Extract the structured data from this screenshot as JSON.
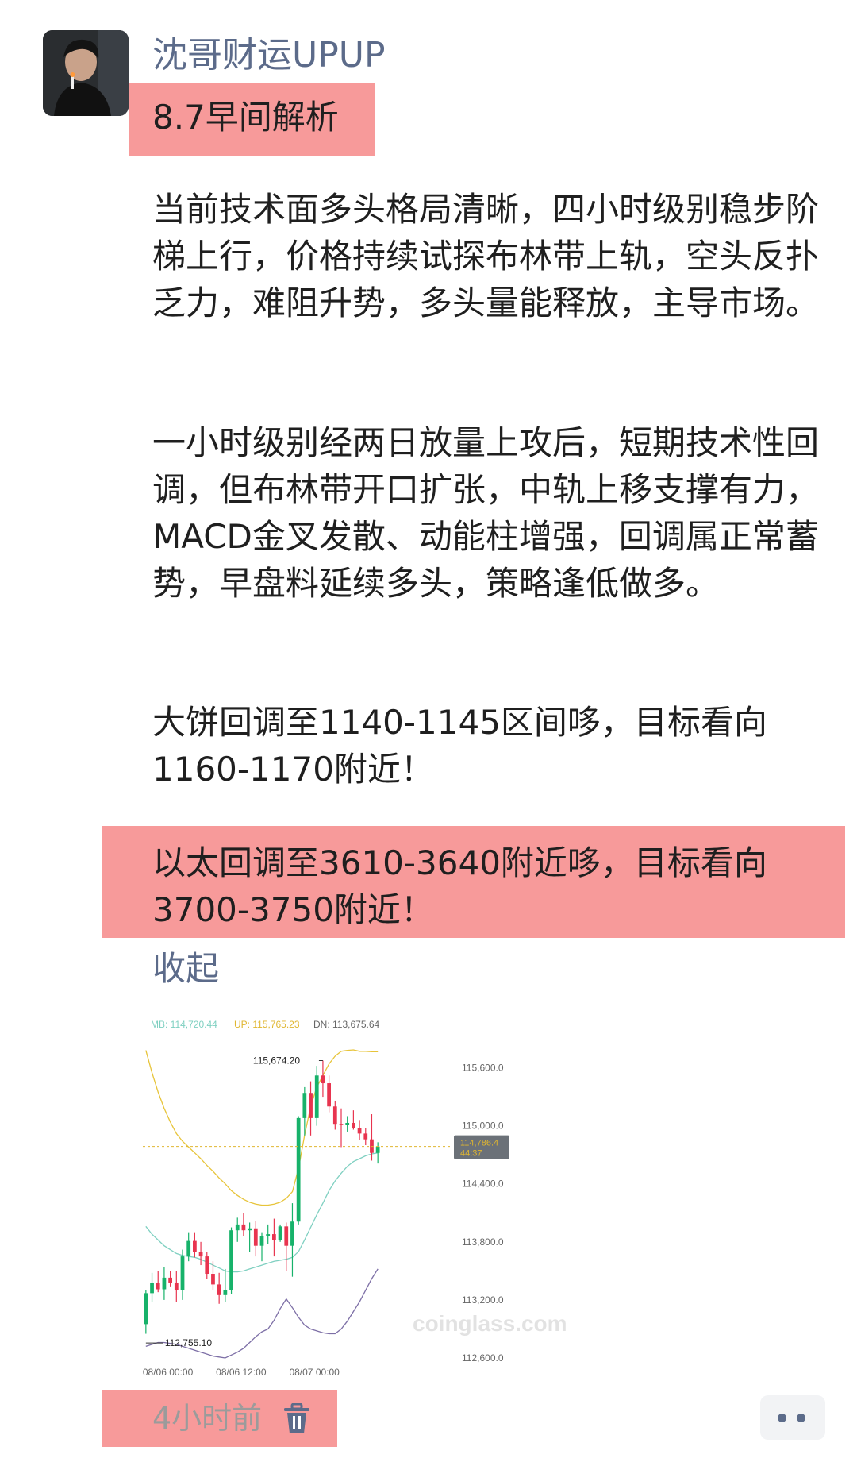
{
  "post": {
    "author": "沈哥财运UPUP",
    "title": "8.7早间解析",
    "paragraphs": [
      "当前技术面多头格局清晰，四小时级别稳步阶梯上行，价格持续试探布林带上轨，空头反扑乏力，难阻升势，多头量能释放，主导市场。",
      "一小时级别经两日放量上攻后，短期技术性回调，但布林带开口扩张，中轨上移支撑有力，MACD金叉发散、动能柱增强，回调属正常蓄势，早盘料延续多头，策略逢低做多。",
      "大饼回调至1140-1145区间哆，目标看向1160-1170附近！",
      "以太回调至3610-3640附近哆，目标看向3700-3750附近！"
    ],
    "collapse_label": "收起",
    "time_label": "4小时前"
  },
  "icons": {
    "avatar": "avatar-photo",
    "delete": "trash-icon",
    "more": "more-dots-icon"
  },
  "colors": {
    "highlight": "#f79a9a",
    "link": "#5c6b8a",
    "candle_up": "#17b26a",
    "candle_down": "#e8344f",
    "boll_up": "#e7c43a",
    "boll_mid": "#7fd0c1",
    "boll_dn": "#7d6fa6"
  },
  "chart_data": {
    "type": "candlestick",
    "legend": {
      "mb": "MB: 114,720.44",
      "up": "UP: 115,765.23",
      "dn": "DN: 113,675.64"
    },
    "x_ticks": [
      "08/06 00:00",
      "08/06 12:00",
      "08/07 00:00"
    ],
    "y_ticks": [
      "115,600.0",
      "115,000.0",
      "114,400.0",
      "113,800.0",
      "113,200.0",
      "112,600.0"
    ],
    "ylim": [
      112600,
      115900
    ],
    "high_label": "115,674.20",
    "low_label": "112,755.10",
    "high_value": 115674.2,
    "low_value": 112755.1,
    "price_tag": {
      "price": "114,786.4",
      "countdown": "44:37",
      "value": 114786.4
    },
    "watermark": "coinglass.com",
    "candles": [
      {
        "o": 112950,
        "h": 113300,
        "l": 112850,
        "c": 113270
      },
      {
        "o": 113270,
        "h": 113480,
        "l": 113180,
        "c": 113380
      },
      {
        "o": 113380,
        "h": 113500,
        "l": 113280,
        "c": 113310
      },
      {
        "o": 113310,
        "h": 113540,
        "l": 113200,
        "c": 113430
      },
      {
        "o": 113430,
        "h": 113500,
        "l": 113340,
        "c": 113380
      },
      {
        "o": 113380,
        "h": 113500,
        "l": 113180,
        "c": 113300
      },
      {
        "o": 113300,
        "h": 113720,
        "l": 113200,
        "c": 113650
      },
      {
        "o": 113650,
        "h": 113900,
        "l": 113600,
        "c": 113810
      },
      {
        "o": 113810,
        "h": 113900,
        "l": 113640,
        "c": 113700
      },
      {
        "o": 113700,
        "h": 113800,
        "l": 113560,
        "c": 113650
      },
      {
        "o": 113650,
        "h": 113700,
        "l": 113420,
        "c": 113470
      },
      {
        "o": 113470,
        "h": 113600,
        "l": 113300,
        "c": 113360
      },
      {
        "o": 113360,
        "h": 113480,
        "l": 113160,
        "c": 113250
      },
      {
        "o": 113250,
        "h": 113520,
        "l": 113180,
        "c": 113300
      },
      {
        "o": 113300,
        "h": 113950,
        "l": 113260,
        "c": 113920
      },
      {
        "o": 113920,
        "h": 114050,
        "l": 113800,
        "c": 113980
      },
      {
        "o": 113980,
        "h": 114100,
        "l": 113860,
        "c": 113920
      },
      {
        "o": 113920,
        "h": 114000,
        "l": 113700,
        "c": 113940
      },
      {
        "o": 113940,
        "h": 114020,
        "l": 113650,
        "c": 113760
      },
      {
        "o": 113760,
        "h": 113900,
        "l": 113600,
        "c": 113860
      },
      {
        "o": 113860,
        "h": 113980,
        "l": 113780,
        "c": 113880
      },
      {
        "o": 113880,
        "h": 114040,
        "l": 113650,
        "c": 113820
      },
      {
        "o": 113820,
        "h": 113980,
        "l": 113800,
        "c": 113960
      },
      {
        "o": 113960,
        "h": 114000,
        "l": 113500,
        "c": 113760
      },
      {
        "o": 113760,
        "h": 114200,
        "l": 113440,
        "c": 114010
      },
      {
        "o": 114010,
        "h": 115100,
        "l": 113980,
        "c": 115080
      },
      {
        "o": 115080,
        "h": 115400,
        "l": 114900,
        "c": 115340
      },
      {
        "o": 115340,
        "h": 115460,
        "l": 114900,
        "c": 115080
      },
      {
        "o": 115080,
        "h": 115620,
        "l": 115000,
        "c": 115520
      },
      {
        "o": 115520,
        "h": 115674,
        "l": 115300,
        "c": 115440
      },
      {
        "o": 115440,
        "h": 115520,
        "l": 115140,
        "c": 115200
      },
      {
        "o": 115200,
        "h": 115260,
        "l": 114960,
        "c": 115020
      },
      {
        "o": 115020,
        "h": 115180,
        "l": 114780,
        "c": 115010
      },
      {
        "o": 115010,
        "h": 115100,
        "l": 114940,
        "c": 115030
      },
      {
        "o": 115030,
        "h": 115160,
        "l": 114960,
        "c": 114980
      },
      {
        "o": 114980,
        "h": 115060,
        "l": 114850,
        "c": 114920
      },
      {
        "o": 114920,
        "h": 114980,
        "l": 114800,
        "c": 114860
      },
      {
        "o": 114860,
        "h": 115120,
        "l": 114640,
        "c": 114720
      },
      {
        "o": 114720,
        "h": 114830,
        "l": 114610,
        "c": 114786
      }
    ],
    "boll_up": [
      115780,
      115550,
      115350,
      115180,
      115040,
      114920,
      114840,
      114780,
      114720,
      114660,
      114590,
      114530,
      114460,
      114400,
      114330,
      114280,
      114240,
      114210,
      114190,
      114180,
      114180,
      114190,
      114210,
      114250,
      114320,
      114560,
      114900,
      115200,
      115400,
      115520,
      115640,
      115720,
      115770,
      115780,
      115785,
      115770,
      115770,
      115765,
      115765
    ],
    "boll_mid": [
      113960,
      113880,
      113820,
      113760,
      113720,
      113680,
      113660,
      113650,
      113640,
      113620,
      113590,
      113560,
      113530,
      113500,
      113490,
      113490,
      113500,
      113520,
      113540,
      113560,
      113580,
      113600,
      113610,
      113620,
      113640,
      113700,
      113820,
      113950,
      114080,
      114200,
      114330,
      114430,
      114510,
      114580,
      114630,
      114660,
      114690,
      114710,
      114720
    ],
    "boll_dn": [
      112720,
      112740,
      112760,
      112760,
      112750,
      112740,
      112720,
      112700,
      112680,
      112660,
      112640,
      112620,
      112610,
      112600,
      112630,
      112660,
      112700,
      112760,
      112820,
      112870,
      112900,
      112990,
      113110,
      113210,
      113120,
      113020,
      112940,
      112900,
      112880,
      112860,
      112850,
      112850,
      112900,
      112980,
      113080,
      113180,
      113300,
      113420,
      113520
    ]
  }
}
